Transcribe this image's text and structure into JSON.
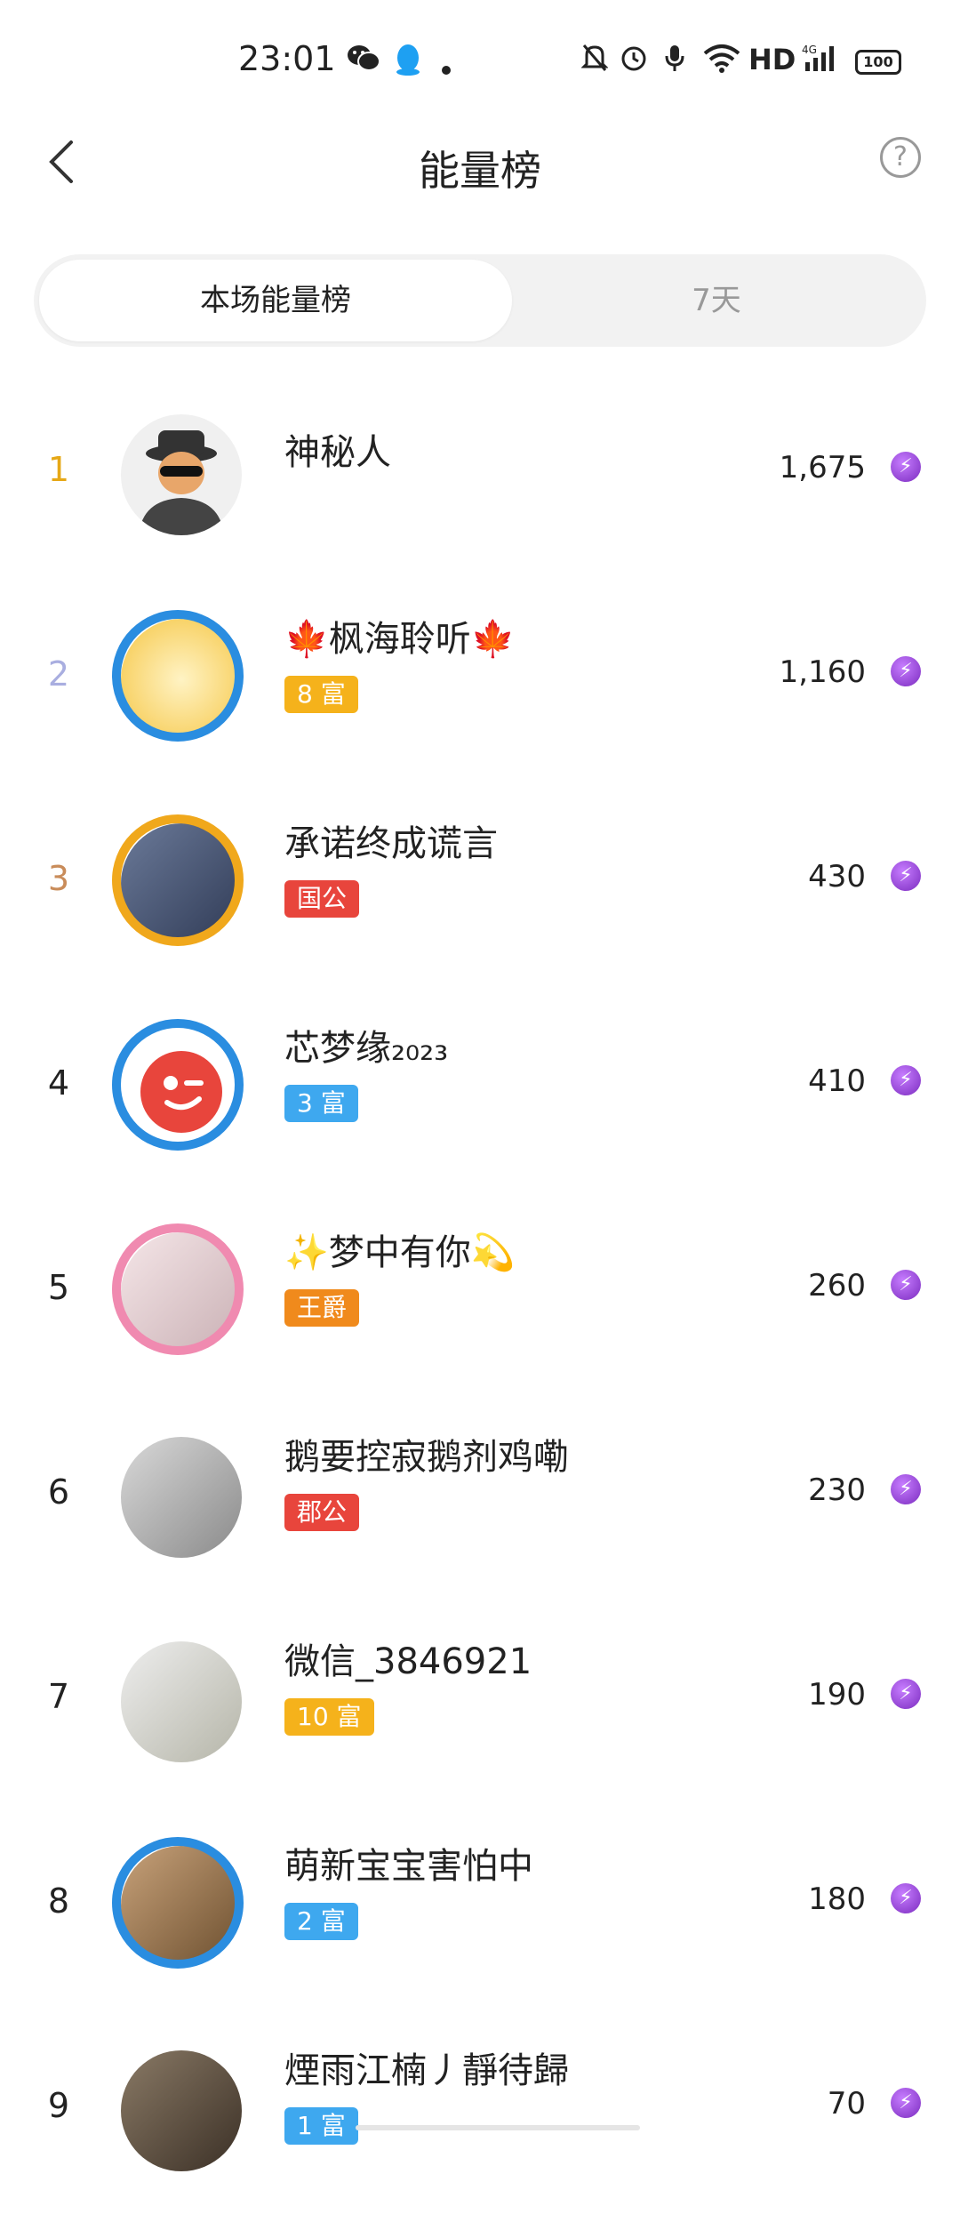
{
  "status_bar": {
    "time": "23:01",
    "hd": "HD",
    "signal": "4G",
    "battery": "100"
  },
  "header": {
    "title": "能量榜",
    "help_symbol": "?"
  },
  "tabs": [
    {
      "label": "本场能量榜",
      "active": true
    },
    {
      "label": "7天",
      "active": false
    }
  ],
  "ranking": [
    {
      "rank": "1",
      "name": "神秘人",
      "badge": "",
      "badge_color": "",
      "score": "1,675",
      "rank_color": "#e6a817",
      "avatar_icon": "spy-avatar"
    },
    {
      "rank": "2",
      "name": "🍁枫海聆听🍁",
      "badge": "8 富",
      "badge_color": "#f5b21b",
      "score": "1,160",
      "rank_color": "#a9aee0",
      "avatar_icon": "leaf-avatar"
    },
    {
      "rank": "3",
      "name": "承诺终成谎言",
      "badge": "国公",
      "badge_color": "#e8453c",
      "score": "430",
      "rank_color": "#c98c5a",
      "avatar_icon": "child-avatar"
    },
    {
      "rank": "4",
      "name": "芯梦缘₂₀₂₃",
      "badge": "3 富",
      "badge_color": "#3ea8ef",
      "score": "410",
      "rank_color": "#222222",
      "avatar_icon": "wink-avatar"
    },
    {
      "rank": "5",
      "name": "✨梦中有你💫",
      "badge": "王爵",
      "badge_color": "#f08a1c",
      "score": "260",
      "rank_color": "#222222",
      "avatar_icon": "woman-avatar"
    },
    {
      "rank": "6",
      "name": "鹅要控寂鹅剂鸡嘞",
      "badge": "郡公",
      "badge_color": "#e8453c",
      "score": "230",
      "rank_color": "#222222",
      "avatar_icon": "cat-avatar"
    },
    {
      "rank": "7",
      "name": "微信_3846921",
      "badge": "10 富",
      "badge_color": "#f5b21b",
      "score": "190",
      "rank_color": "#222222",
      "avatar_icon": "art-avatar"
    },
    {
      "rank": "8",
      "name": "萌新宝宝害怕中",
      "badge": "2 富",
      "badge_color": "#3ea8ef",
      "score": "180",
      "rank_color": "#222222",
      "avatar_icon": "food-avatar"
    },
    {
      "rank": "9",
      "name": "煙雨江楠丿靜待歸",
      "badge": "1 富",
      "badge_color": "#3ea8ef",
      "score": "70",
      "rank_color": "#222222",
      "avatar_icon": "table-avatar"
    }
  ],
  "energy_icon": "energy-bolt-icon",
  "colors": {
    "accent": "#7b2cbf",
    "tab_bg": "#f2f2f2"
  }
}
